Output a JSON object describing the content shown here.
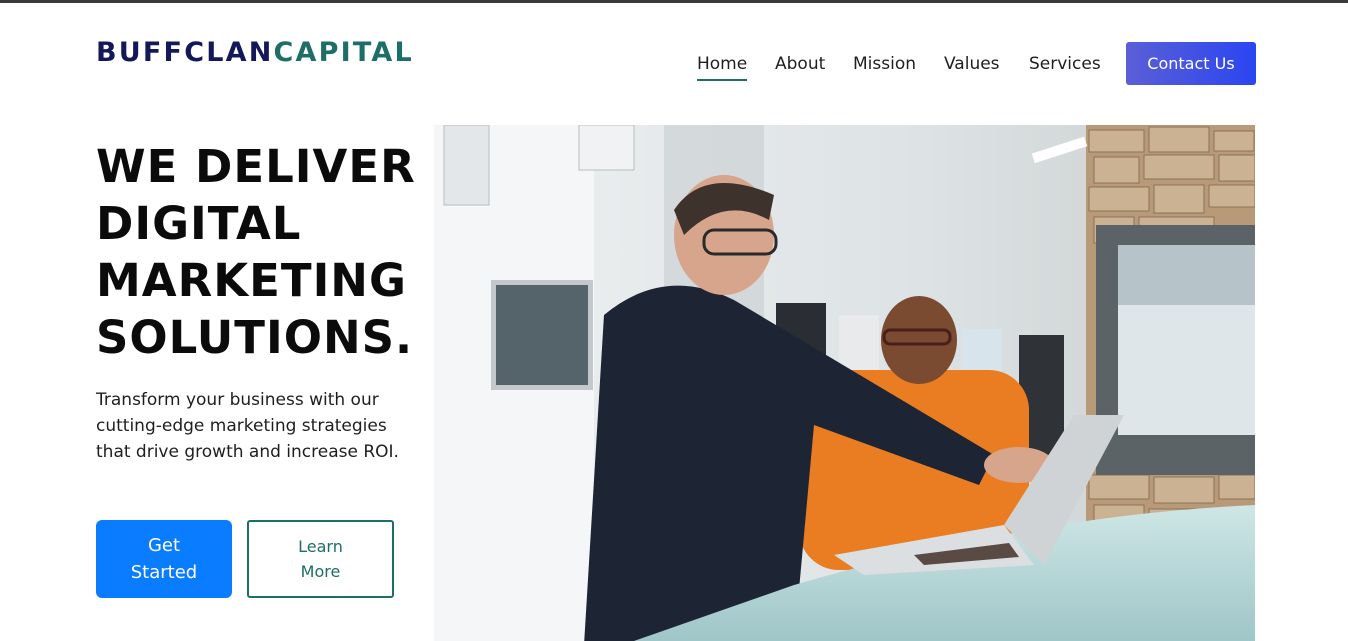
{
  "brand": {
    "part1": "BUFFCLAN",
    "part2": "CAPITAL"
  },
  "nav": {
    "items": [
      {
        "label": "Home",
        "active": true
      },
      {
        "label": "About"
      },
      {
        "label": "Mission"
      },
      {
        "label": "Values"
      },
      {
        "label": "Services"
      }
    ],
    "cta": "Contact Us"
  },
  "hero": {
    "title_lines": [
      "WE DELIVER",
      "DIGITAL",
      "MARKETING",
      "SOLUTIONS."
    ],
    "subtitle": "Transform your business with our cutting-edge marketing strategies that drive growth and increase ROI.",
    "primary_button": "Get Started",
    "secondary_button": "Learn More"
  },
  "colors": {
    "brand_navy": "#14185a",
    "brand_teal": "#1d6e66",
    "primary_blue": "#0a7cff",
    "cta_gradient_start": "#5b5fd6",
    "cta_gradient_end": "#2a45f2"
  }
}
